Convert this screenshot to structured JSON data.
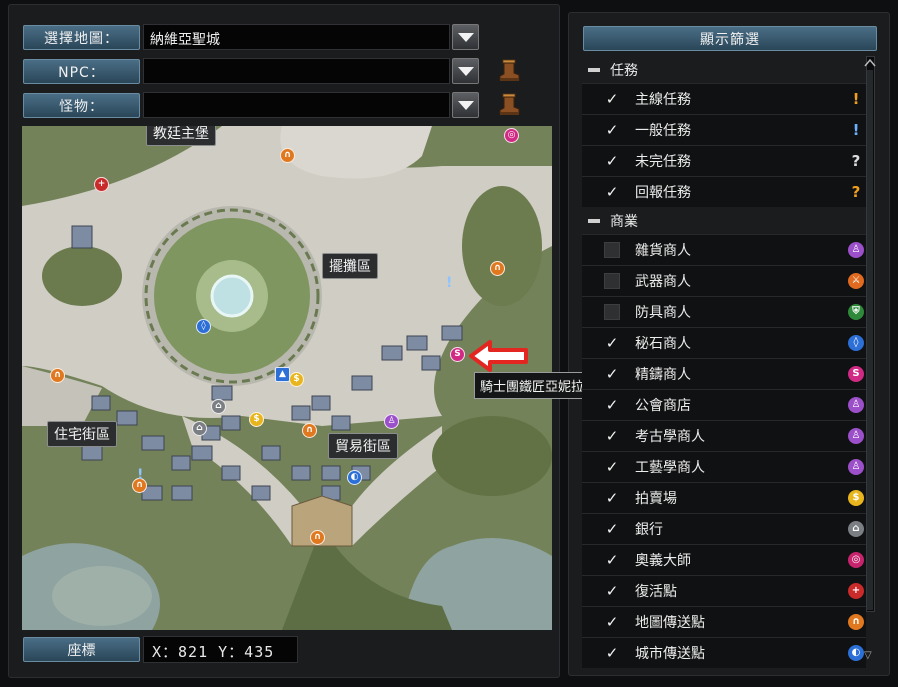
{
  "header": {
    "map_label": "選擇地圖：",
    "map_value": "納維亞聖城",
    "npc_label": "NPC：",
    "npc_value": "",
    "monster_label": "怪物：",
    "monster_value": ""
  },
  "map": {
    "labels": {
      "church": "教廷主堡",
      "stalls": "擺攤區",
      "residential": "住宅街區",
      "trade": "貿易街區"
    },
    "tooltip": "騎士團鐵匠亞妮拉絲",
    "arrow_color": "#e3261f"
  },
  "coords": {
    "label": "座標",
    "value": "X：821  Y：435"
  },
  "filter": {
    "title": "顯示篩選",
    "sections": [
      {
        "name": "任務",
        "items": [
          {
            "label": "主線任務",
            "checked": true,
            "icon": "exclamation-orange-icon"
          },
          {
            "label": "一般任務",
            "checked": true,
            "icon": "exclamation-blue-icon"
          },
          {
            "label": "未完任務",
            "checked": true,
            "icon": "question-white-icon"
          },
          {
            "label": "回報任務",
            "checked": true,
            "icon": "question-orange-icon"
          }
        ]
      },
      {
        "name": "商業",
        "items": [
          {
            "label": "雜貨商人",
            "checked": false,
            "icon": "general-store-icon",
            "color": "#9b4fc9"
          },
          {
            "label": "武器商人",
            "checked": false,
            "icon": "weapon-shop-icon",
            "color": "#e06a1f"
          },
          {
            "label": "防具商人",
            "checked": false,
            "icon": "armor-shop-icon",
            "color": "#2e8a3a"
          },
          {
            "label": "秘石商人",
            "checked": true,
            "icon": "stone-shop-icon",
            "color": "#2c6fd6"
          },
          {
            "label": "精鑄商人",
            "checked": true,
            "icon": "forge-shop-icon",
            "color": "#d12a85"
          },
          {
            "label": "公會商店",
            "checked": true,
            "icon": "guild-shop-icon",
            "color": "#9b4fc9"
          },
          {
            "label": "考古學商人",
            "checked": true,
            "icon": "archaeology-shop-icon",
            "color": "#9b4fc9"
          },
          {
            "label": "工藝學商人",
            "checked": true,
            "icon": "craft-shop-icon",
            "color": "#9b4fc9"
          },
          {
            "label": "拍賣場",
            "checked": true,
            "icon": "auction-icon",
            "color": "#e8b51d"
          },
          {
            "label": "銀行",
            "checked": true,
            "icon": "bank-icon",
            "color": "#7b7f84"
          },
          {
            "label": "奧義大師",
            "checked": true,
            "icon": "skill-master-icon",
            "color": "#c8246e"
          },
          {
            "label": "復活點",
            "checked": true,
            "icon": "revive-point-icon",
            "color": "#c92a2a"
          },
          {
            "label": "地圖傳送點",
            "checked": true,
            "icon": "map-teleport-icon",
            "color": "#e0781f"
          },
          {
            "label": "城市傳送點",
            "checked": true,
            "icon": "city-teleport-icon",
            "color": "#2c6fd6"
          }
        ]
      }
    ]
  }
}
